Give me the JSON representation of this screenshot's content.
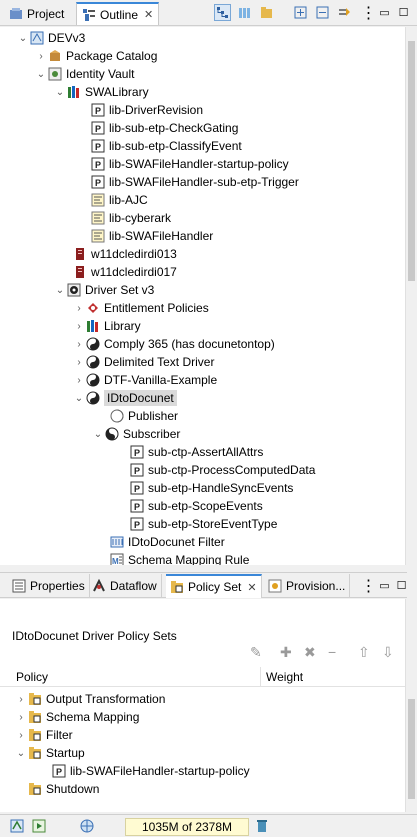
{
  "top_tabs": {
    "project": "Project",
    "outline": "Outline"
  },
  "outline": {
    "root": "DEVv3",
    "package_catalog": "Package Catalog",
    "identity_vault": "Identity Vault",
    "swalibrary": "SWALibrary",
    "swa_items": [
      "lib-DriverRevision",
      "lib-sub-etp-CheckGating",
      "lib-sub-etp-ClassifyEvent",
      "lib-SWAFileHandler-startup-policy",
      "lib-SWAFileHandler-sub-etp-Trigger",
      "lib-AJC",
      "lib-cyberark",
      "lib-SWAFileHandler"
    ],
    "servers": [
      "w11dcledirdi013",
      "w11dcledirdi017"
    ],
    "driver_set": "Driver Set v3",
    "ds_items": [
      "Entitlement Policies",
      "Library",
      "Comply 365 (has docunetontop)",
      "Delimited Text Driver",
      "DTF-Vanilla-Example"
    ],
    "idtodocunet": "IDtoDocunet",
    "publisher": "Publisher",
    "subscriber": "Subscriber",
    "sub_items": [
      "sub-ctp-AssertAllAttrs",
      "sub-ctp-ProcessComputedData",
      "sub-etp-HandleSyncEvents",
      "sub-etp-ScopeEvents",
      "sub-etp-StoreEventType"
    ],
    "filter": "IDtoDocunet Filter",
    "schema_rule": "Schema Mapping Rule"
  },
  "bottom_tabs": {
    "properties": "Properties",
    "dataflow": "Dataflow",
    "policy_set": "Policy Set",
    "provision": "Provision..."
  },
  "policy_set": {
    "title": "IDtoDocunet Driver Policy Sets",
    "col_policy": "Policy",
    "col_weight": "Weight",
    "rows": [
      "Output Transformation",
      "Schema Mapping",
      "Filter",
      "Startup",
      "lib-SWAFileHandler-startup-policy",
      "Shutdown"
    ]
  },
  "status": {
    "heap": "1035M of 2378M"
  },
  "colors": {
    "accent": "#3a87d8",
    "selection": "#dadada",
    "heap_bg": "#fffbd2"
  }
}
